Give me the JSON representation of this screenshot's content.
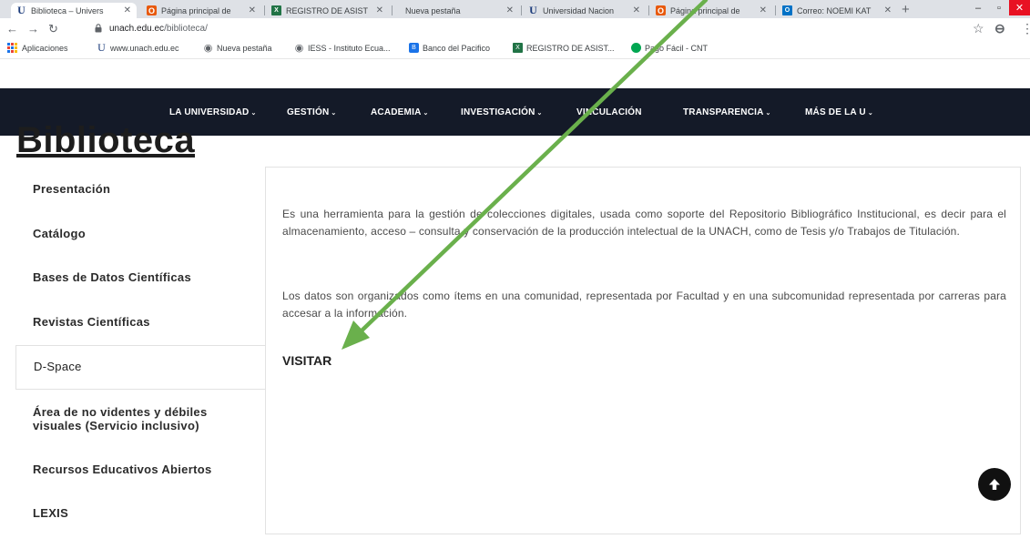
{
  "browser": {
    "tabs": [
      {
        "title": "Biblioteca – Univers",
        "icon": "unach-u-icon",
        "active": true
      },
      {
        "title": "Página principal de",
        "icon": "office-icon"
      },
      {
        "title": "REGISTRO DE ASIST",
        "icon": "excel-icon"
      },
      {
        "title": "Nueva pestaña",
        "icon": ""
      },
      {
        "title": "Universidad Nacion",
        "icon": "unach-u-icon"
      },
      {
        "title": "Página principal de",
        "icon": "office-icon"
      },
      {
        "title": "Correo: NOEMI KAT",
        "icon": "outlook-icon"
      }
    ],
    "url_host": "unach.edu.ec",
    "url_path": "/biblioteca/",
    "bookmarks": [
      {
        "label": "Aplicaciones",
        "icon": "apps-icon"
      },
      {
        "label": "www.unach.edu.ec",
        "icon": "unach-u-icon"
      },
      {
        "label": "Nueva pestaña",
        "icon": "globe-icon"
      },
      {
        "label": "IESS - Instituto Ecua...",
        "icon": "globe-icon"
      },
      {
        "label": "Banco del Pacifico",
        "icon": "bank-icon"
      },
      {
        "label": "REGISTRO DE ASIST...",
        "icon": "excel-icon"
      },
      {
        "label": "Pago Fácil - CNT",
        "icon": "cnt-icon"
      }
    ]
  },
  "nav": {
    "items": [
      "LA UNIVERSIDAD",
      "GESTIÓN",
      "ACADEMIA",
      "INVESTIGACIÓN",
      "VINCULACIÓN",
      "TRANSPARENCIA",
      "MÁS DE LA U"
    ],
    "caret": "⌄"
  },
  "page": {
    "title": "Biblioteca"
  },
  "sidebar": {
    "items": [
      "Presentación",
      "Catálogo",
      "Bases de Datos Científicas",
      "Revistas Científicas",
      "D-Space",
      "Área de no videntes y débiles",
      "visuales (Servicio inclusivo)",
      "Recursos Educativos Abiertos",
      "LEXIS"
    ]
  },
  "content": {
    "paragraph1": "Es una herramienta para la gestión de colecciones digitales, usada como soporte del Repositorio Bibliográfico Institucional, es decir para el almacenamiento, acceso – consulta y conservación de la producción intelectual de la UNACH, como de Tesis y/o Trabajos de Titulación.",
    "paragraph2": "Los datos son organizados como ítems en una comunidad, representada por Facultad y en una subcomunidad representada por carreras para accesar a la información.",
    "visit_label": "VISITAR"
  },
  "colors": {
    "nav_bg": "#141a28",
    "arrow": "#6ab04c"
  }
}
